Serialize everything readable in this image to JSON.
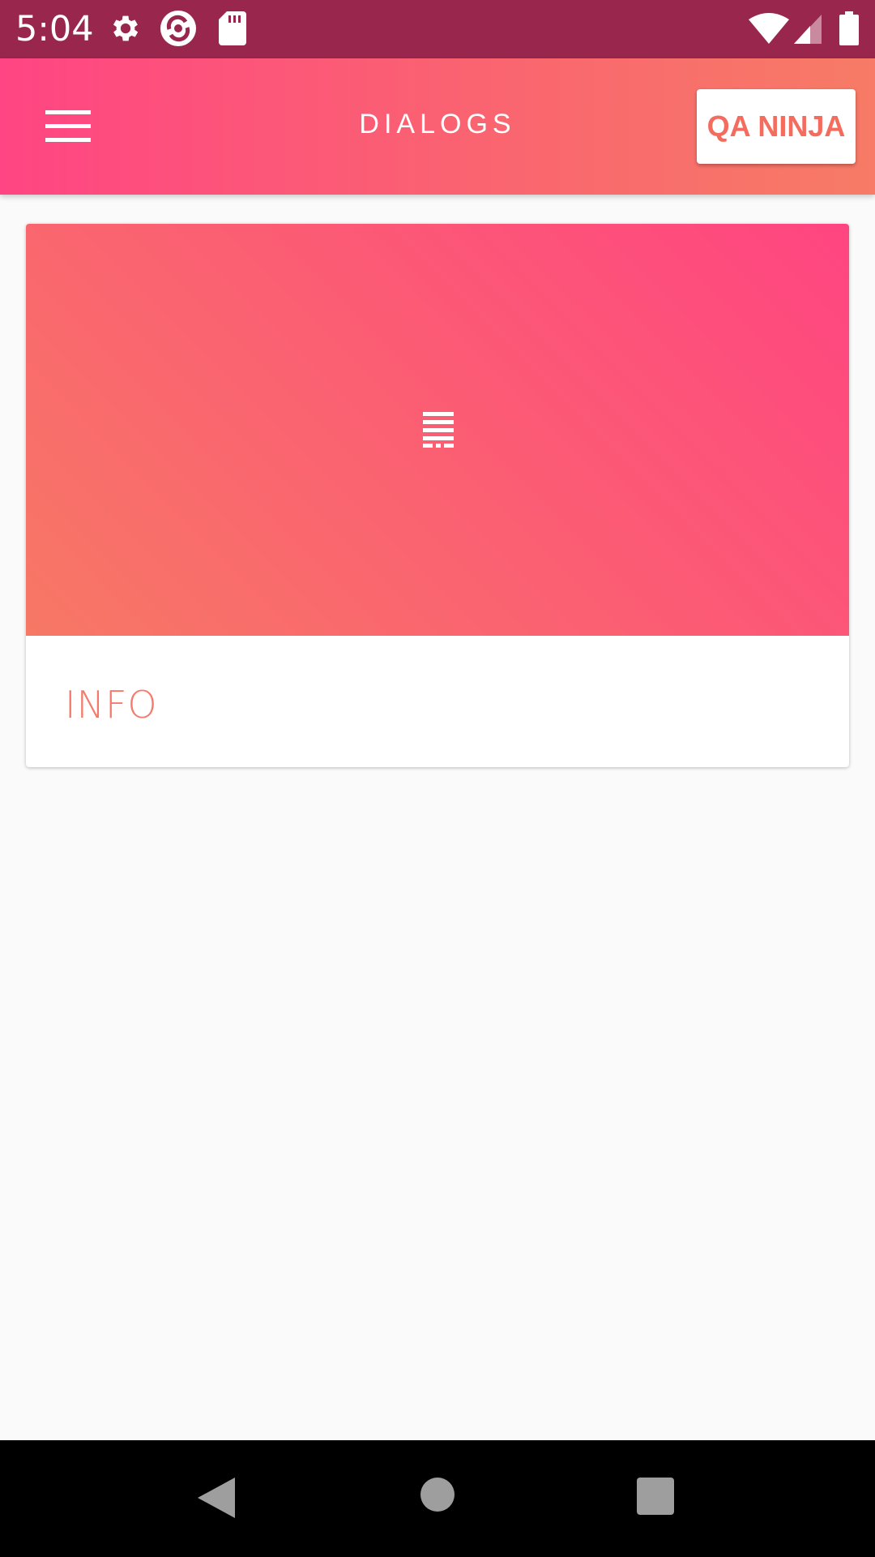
{
  "status_bar": {
    "time": "5:04",
    "left_icons": [
      "gear-icon",
      "sync-app-icon",
      "sd-card-icon"
    ],
    "right_icons": [
      "wifi-icon",
      "cell-signal-icon",
      "battery-icon"
    ],
    "background": "#99264d"
  },
  "toolbar": {
    "title": "DIALOGS",
    "menu_icon": "hamburger-menu-icon",
    "action_button_label": "QA NINJA",
    "gradient": [
      "#ff4583",
      "#f77b66"
    ]
  },
  "card": {
    "media_icon": "list-lines-icon",
    "action_label": "INFO",
    "accent": "#f47a6c",
    "gradient": [
      "#ff4581",
      "#f77865"
    ]
  },
  "nav_bar": {
    "buttons": [
      "back-icon",
      "home-icon",
      "recents-icon"
    ]
  }
}
